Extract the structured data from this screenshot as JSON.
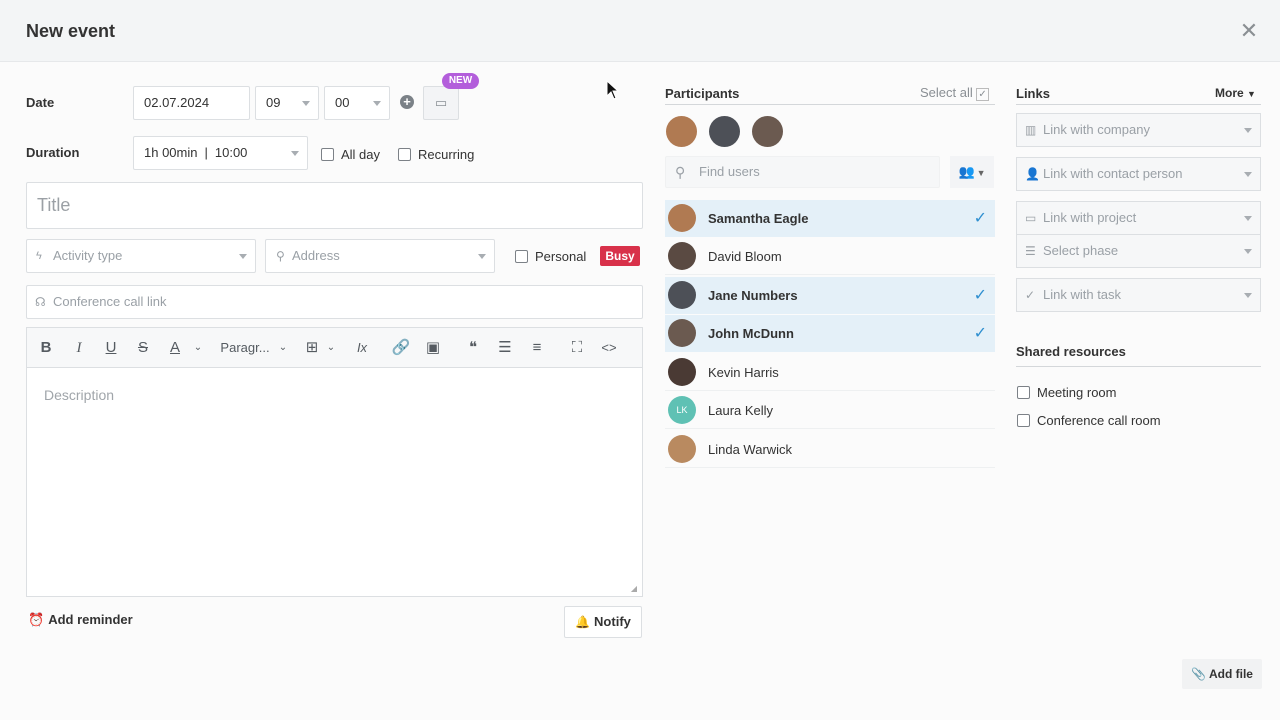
{
  "header": {
    "title": "New event",
    "close_icon": "close-icon"
  },
  "date": {
    "label": "Date",
    "value": "02.07.2024",
    "hour": "09",
    "minute": "00",
    "new_badge": "NEW"
  },
  "duration": {
    "label": "Duration",
    "value": "1h 00min",
    "end": "10:00",
    "all_day": "All day",
    "recurring": "Recurring"
  },
  "title_field": {
    "placeholder": "Title"
  },
  "activity_type": {
    "placeholder": "Activity type"
  },
  "address": {
    "placeholder": "Address"
  },
  "personal": {
    "label": "Personal",
    "status": "Busy"
  },
  "conference": {
    "placeholder": "Conference call link"
  },
  "toolbar": {
    "bold": "B",
    "italic": "I",
    "underline": "U",
    "strike": "S",
    "color": "A",
    "paragraph": "Paragr...",
    "table": "⊞",
    "clear_format": "Ix",
    "quote": "❝"
  },
  "description": {
    "placeholder": "Description"
  },
  "footer": {
    "add_reminder": "Add reminder",
    "notify": "Notify",
    "add_file": "Add file"
  },
  "participants": {
    "title": "Participants",
    "select_all": "Select all",
    "search_placeholder": "Find users",
    "users": [
      {
        "name": "Samantha Eagle",
        "selected": true,
        "color": "#b07a52"
      },
      {
        "name": "David Bloom",
        "selected": false,
        "color": "#5a4a42"
      },
      {
        "name": "Jane Numbers",
        "selected": true,
        "color": "#4d5057"
      },
      {
        "name": "John McDunn",
        "selected": true,
        "color": "#6b5a50"
      },
      {
        "name": "Kevin Harris",
        "selected": false,
        "color": "#4a3a34"
      },
      {
        "name": "Laura Kelly",
        "selected": false,
        "color": "#5fc1b4",
        "initials": "LK"
      },
      {
        "name": "Linda Warwick",
        "selected": false,
        "color": "#b98a60"
      }
    ]
  },
  "links": {
    "title": "Links",
    "more": "More",
    "company": "Link with company",
    "contact": "Link with contact person",
    "project": "Link with project",
    "phase": "Select phase",
    "task": "Link with task"
  },
  "shared_resources": {
    "title": "Shared resources",
    "meeting_room": "Meeting room",
    "conference_room": "Conference call room"
  }
}
